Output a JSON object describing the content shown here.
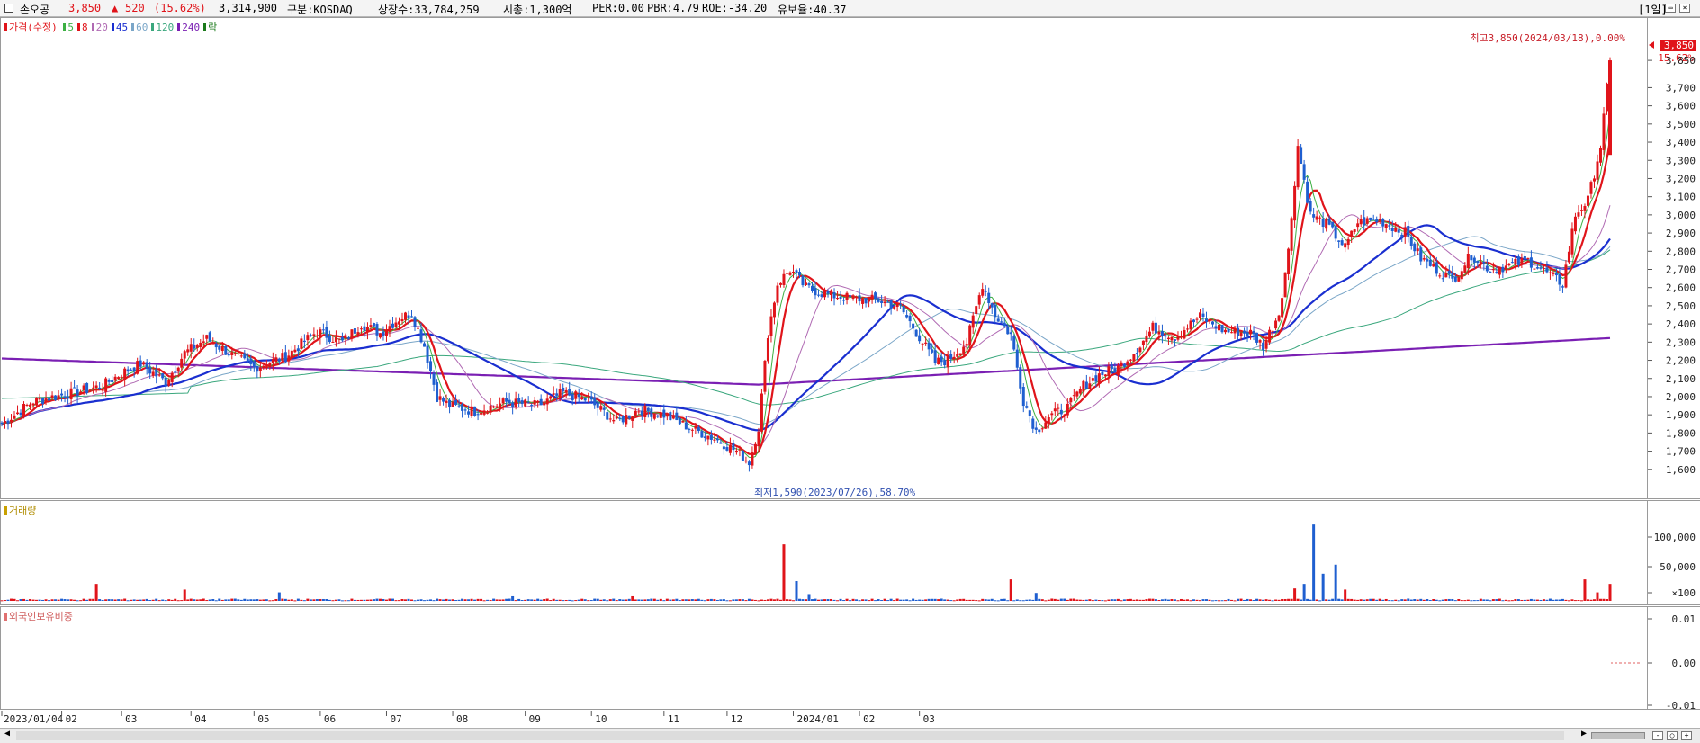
{
  "header": {
    "name": "손오공",
    "price": "3,850",
    "change_arrow": "▲",
    "change": "520",
    "change_pct": "(15.62%)",
    "volume": "3,314,900",
    "market": "구분:KOSDAQ",
    "listed": "상장수:33,784,259",
    "market_cap": "시총:1,300억",
    "per": "PER:0.00",
    "pbr": "PBR:4.79",
    "roe": "ROE:-34.20",
    "float": "유보율:40.37",
    "period": "[1일]"
  },
  "legend": {
    "price_label": "가격(수정)",
    "ma": [
      {
        "label": "5",
        "color": "#3cb043"
      },
      {
        "label": "8",
        "color": "#e0141a"
      },
      {
        "label": "20",
        "color": "#b06ab3"
      },
      {
        "label": "45",
        "color": "#1a2fd0"
      },
      {
        "label": "60",
        "color": "#7aa6c8"
      },
      {
        "label": "120",
        "color": "#3aa77d"
      },
      {
        "label": "240",
        "color": "#7a1fb3"
      },
      {
        "label": "락",
        "color": "#1b7a1b"
      }
    ]
  },
  "annotations": {
    "high": "최고3,850(2024/03/18),0.00%",
    "low": "최저1,590(2023/07/26),58.70%",
    "last_price": "3,850",
    "last_pct": "15.62%"
  },
  "volume_panel": {
    "title": "거래량"
  },
  "foreign_panel": {
    "title": "외국인보유비중"
  },
  "chart_data": {
    "type": "candlestick",
    "price_axis": {
      "ticks": [
        1600,
        1700,
        1800,
        1900,
        2000,
        2100,
        2200,
        2300,
        2400,
        2500,
        2600,
        2700,
        2800,
        2900,
        3000,
        3100,
        3200,
        3300,
        3400,
        3500,
        3600,
        3700,
        3850
      ]
    },
    "volume_axis": {
      "ticks": [
        "100,000",
        "50,000",
        "×100"
      ]
    },
    "foreign_axis": {
      "ticks": [
        "0.01",
        "0.00",
        "-0.01"
      ]
    },
    "x_labels": [
      "2023/01/04",
      "02",
      "03",
      "04",
      "05",
      "06",
      "07",
      "08",
      "09",
      "10",
      "11",
      "12",
      "2024/01",
      "02",
      "03"
    ],
    "keypoints": [
      [
        0,
        1850
      ],
      [
        10,
        1975
      ],
      [
        25,
        2030
      ],
      [
        32,
        2060
      ],
      [
        38,
        2130
      ],
      [
        44,
        2180
      ],
      [
        52,
        2080
      ],
      [
        58,
        2240
      ],
      [
        65,
        2320
      ],
      [
        72,
        2240
      ],
      [
        80,
        2160
      ],
      [
        90,
        2220
      ],
      [
        100,
        2360
      ],
      [
        108,
        2300
      ],
      [
        114,
        2400
      ],
      [
        120,
        2350
      ],
      [
        126,
        2430
      ],
      [
        130,
        2460
      ],
      [
        134,
        2280
      ],
      [
        138,
        2000
      ],
      [
        142,
        1950
      ],
      [
        150,
        1920
      ],
      [
        160,
        1970
      ],
      [
        170,
        1950
      ],
      [
        178,
        2020
      ],
      [
        186,
        1980
      ],
      [
        195,
        1860
      ],
      [
        202,
        1930
      ],
      [
        210,
        1900
      ],
      [
        218,
        1830
      ],
      [
        226,
        1770
      ],
      [
        233,
        1700
      ],
      [
        237,
        1640
      ],
      [
        240,
        1830
      ],
      [
        243,
        2350
      ],
      [
        246,
        2620
      ],
      [
        250,
        2700
      ],
      [
        255,
        2600
      ],
      [
        262,
        2560
      ],
      [
        270,
        2540
      ],
      [
        278,
        2530
      ],
      [
        285,
        2490
      ],
      [
        292,
        2300
      ],
      [
        296,
        2190
      ],
      [
        300,
        2200
      ],
      [
        306,
        2300
      ],
      [
        311,
        2620
      ],
      [
        315,
        2450
      ],
      [
        320,
        2340
      ],
      [
        324,
        1980
      ],
      [
        328,
        1810
      ],
      [
        332,
        1890
      ],
      [
        338,
        1940
      ],
      [
        343,
        2060
      ],
      [
        348,
        2120
      ],
      [
        354,
        2160
      ],
      [
        360,
        2260
      ],
      [
        365,
        2380
      ],
      [
        372,
        2330
      ],
      [
        380,
        2440
      ],
      [
        388,
        2360
      ],
      [
        396,
        2350
      ],
      [
        400,
        2280
      ],
      [
        405,
        2460
      ],
      [
        408,
        2800
      ],
      [
        411,
        3380
      ],
      [
        415,
        3000
      ],
      [
        420,
        2950
      ],
      [
        426,
        2820
      ],
      [
        430,
        2960
      ],
      [
        437,
        2970
      ],
      [
        445,
        2900
      ],
      [
        450,
        2760
      ],
      [
        455,
        2700
      ],
      [
        460,
        2640
      ],
      [
        466,
        2780
      ],
      [
        472,
        2700
      ],
      [
        478,
        2720
      ],
      [
        484,
        2750
      ],
      [
        490,
        2680
      ],
      [
        495,
        2620
      ],
      [
        499,
        3000
      ],
      [
        503,
        3080
      ],
      [
        507,
        3380
      ],
      [
        510,
        3850
      ]
    ],
    "total_days": 511,
    "volume_spikes": [
      [
        30,
        30
      ],
      [
        58,
        20
      ],
      [
        88,
        15
      ],
      [
        162,
        8
      ],
      [
        200,
        8
      ],
      [
        248,
        100
      ],
      [
        252,
        35
      ],
      [
        256,
        12
      ],
      [
        320,
        38
      ],
      [
        328,
        14
      ],
      [
        410,
        22
      ],
      [
        413,
        30
      ],
      [
        416,
        135
      ],
      [
        419,
        48
      ],
      [
        423,
        64
      ],
      [
        426,
        20
      ],
      [
        502,
        38
      ],
      [
        506,
        15
      ],
      [
        510,
        30
      ]
    ],
    "moving_averages": [
      "5",
      "8",
      "20",
      "45",
      "60",
      "120",
      "240"
    ]
  }
}
